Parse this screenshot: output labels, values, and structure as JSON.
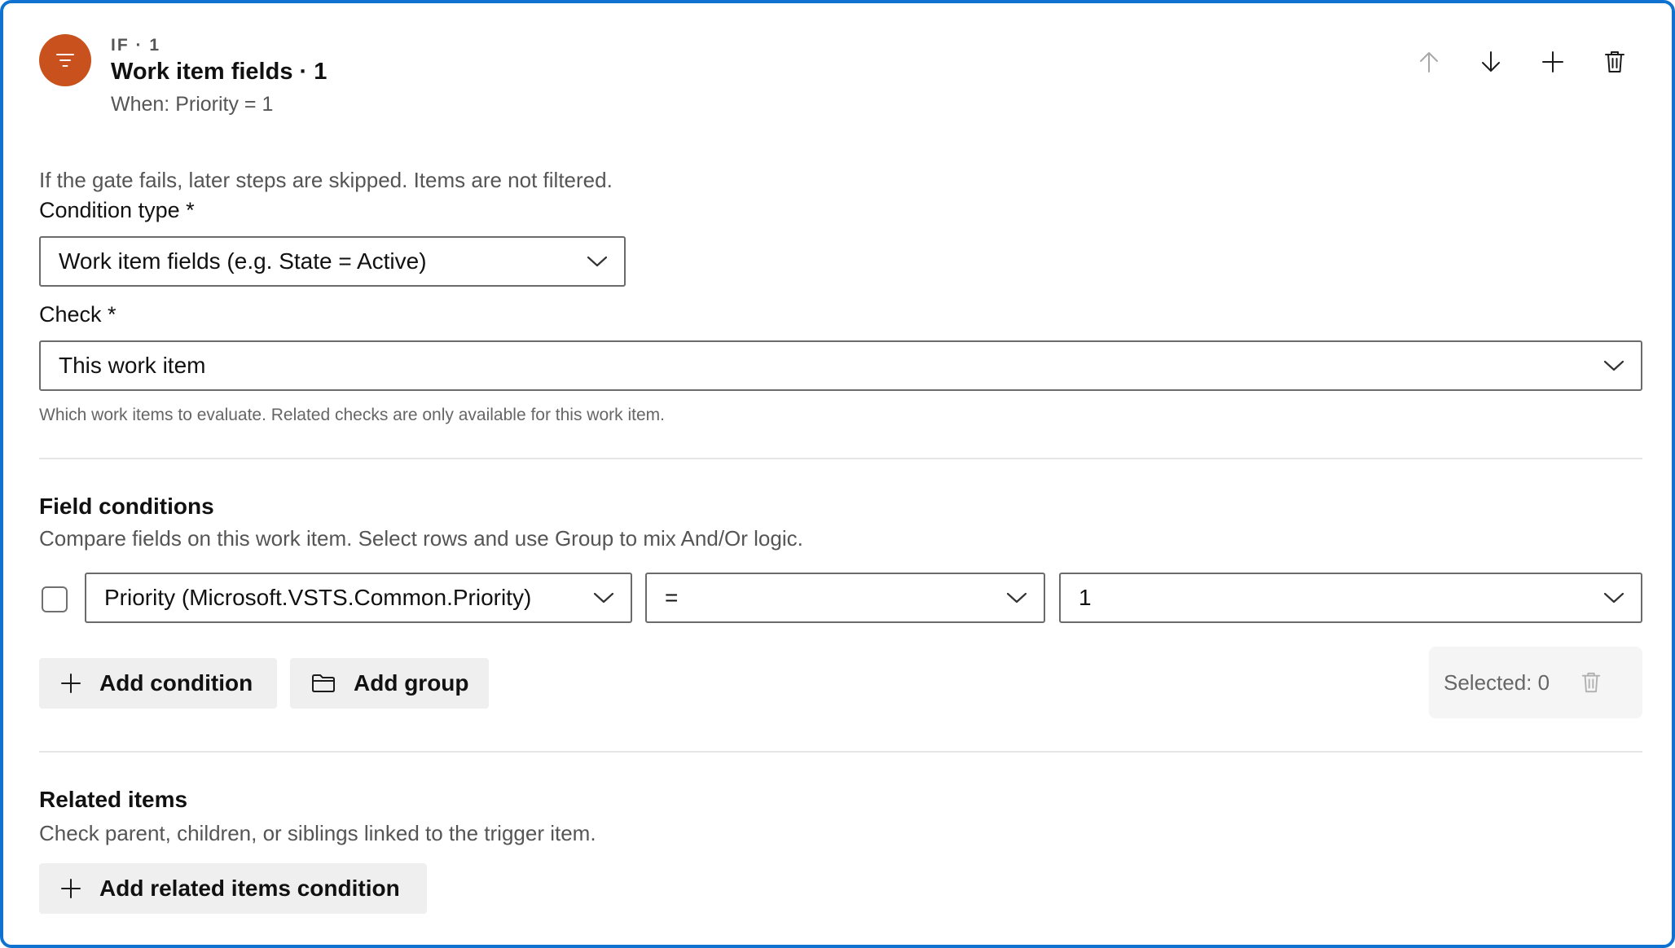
{
  "header": {
    "eyebrow": "IF · 1",
    "title": "Work item fields · 1",
    "subtitle": "When: Priority = 1",
    "icon": "filter-icon",
    "icon_color": "#c9511d",
    "toolbar": [
      {
        "name": "move-up",
        "icon": "arrow-up-icon",
        "disabled": true
      },
      {
        "name": "move-down",
        "icon": "arrow-down-icon",
        "disabled": false
      },
      {
        "name": "add-step",
        "icon": "plus-icon",
        "disabled": false
      },
      {
        "name": "delete-step",
        "icon": "trash-icon",
        "disabled": false
      }
    ]
  },
  "gate_note": "If the gate fails, later steps are skipped. Items are not filtered.",
  "condition_type": {
    "label": "Condition type *",
    "value": "Work item fields (e.g. State = Active)"
  },
  "check": {
    "label": "Check *",
    "value": "This work item",
    "help": "Which work items to evaluate. Related checks are only available for this work item."
  },
  "field_conditions": {
    "title": "Field conditions",
    "description": "Compare fields on this work item. Select rows and use Group to mix And/Or logic.",
    "rows": [
      {
        "checked": false,
        "field": "Priority (Microsoft.VSTS.Common.Priority)",
        "operator": "=",
        "value": "1"
      }
    ],
    "add_condition_label": "Add condition",
    "add_group_label": "Add group",
    "selected_label": "Selected: 0"
  },
  "related_items": {
    "title": "Related items",
    "description": "Check parent, children, or siblings linked to the trigger item.",
    "add_label": "Add related items condition"
  },
  "colors": {
    "border_accent": "#0f72d0",
    "button_bg": "#efefef"
  }
}
